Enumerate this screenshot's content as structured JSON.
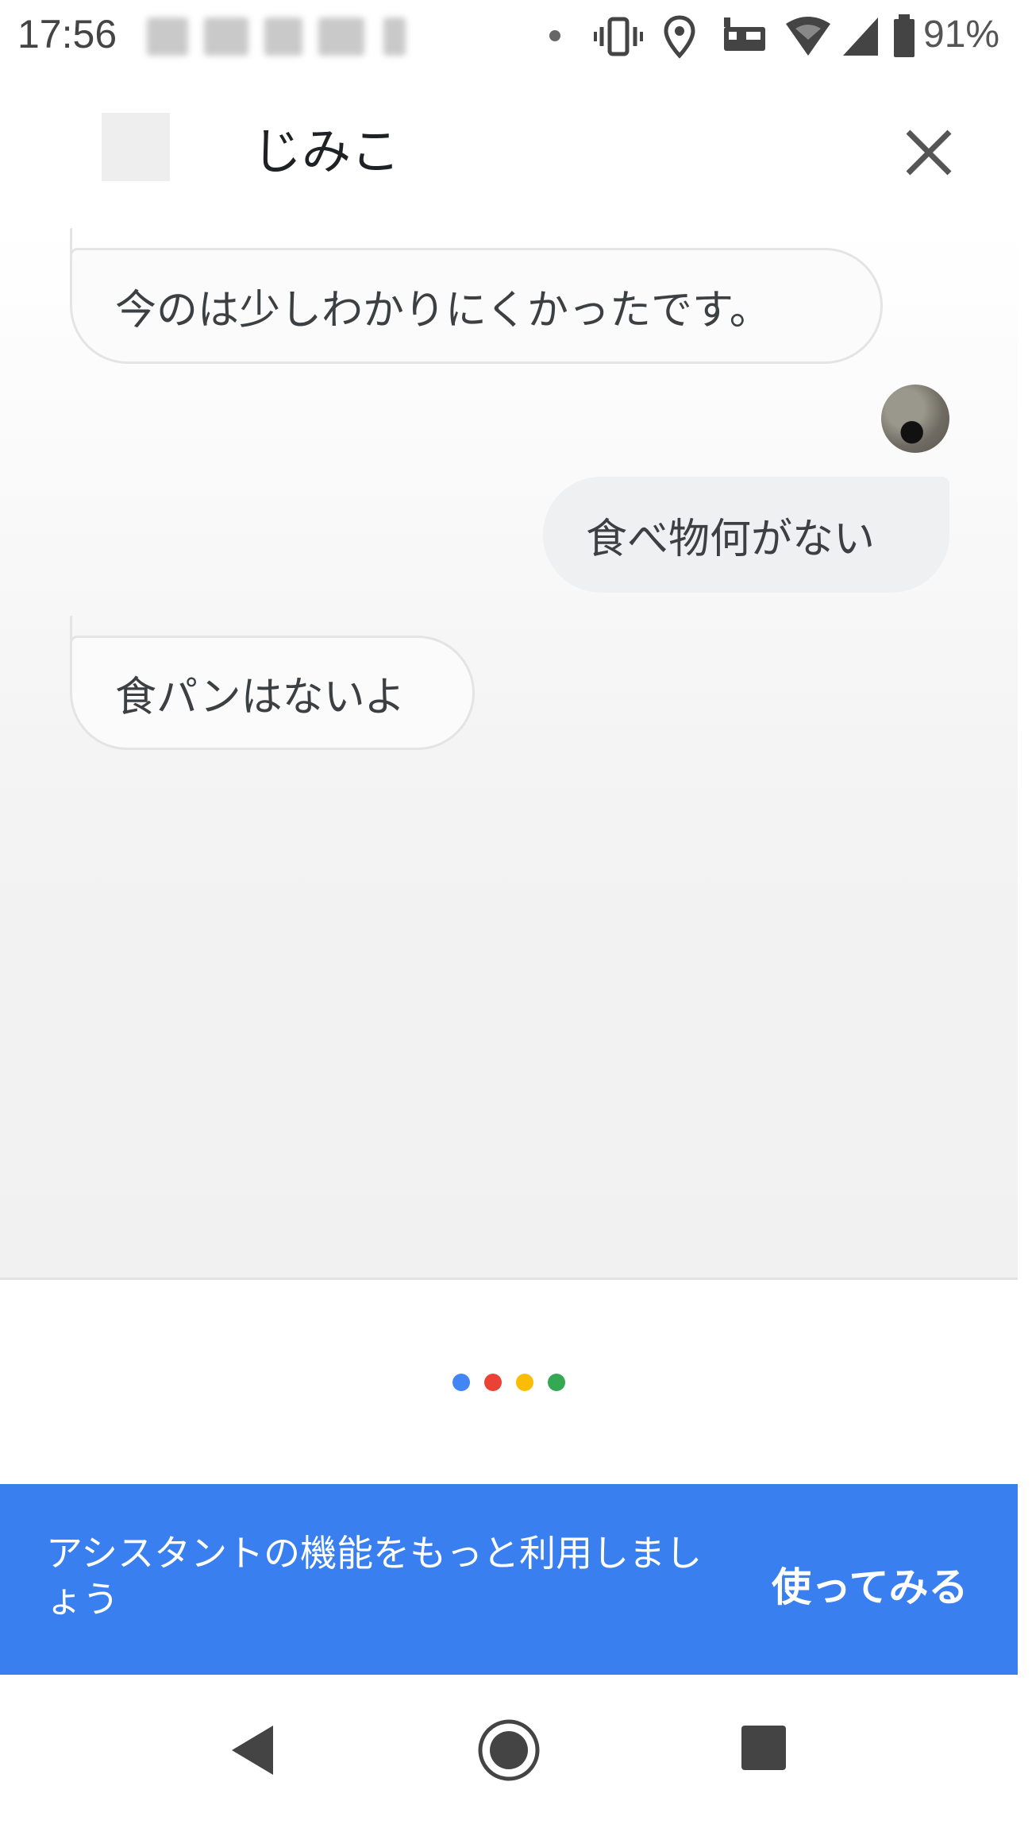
{
  "status_bar": {
    "time": "17:56",
    "battery": "91%"
  },
  "header": {
    "title": "じみこ"
  },
  "conversation": {
    "messages": [
      {
        "from": "assistant",
        "text": "今のは少しわかりにくかったです。"
      },
      {
        "from": "user",
        "text": "食べ物何がない"
      },
      {
        "from": "assistant",
        "text": "食パンはないよ"
      }
    ]
  },
  "promo": {
    "text": "アシスタントの機能をもっと利用しましょう",
    "button": "使ってみる"
  },
  "colors": {
    "promo_background": "#3a7ff0",
    "dot_blue": "#4285f4",
    "dot_red": "#ea4335",
    "dot_yellow": "#fbbc05",
    "dot_green": "#34a853"
  }
}
